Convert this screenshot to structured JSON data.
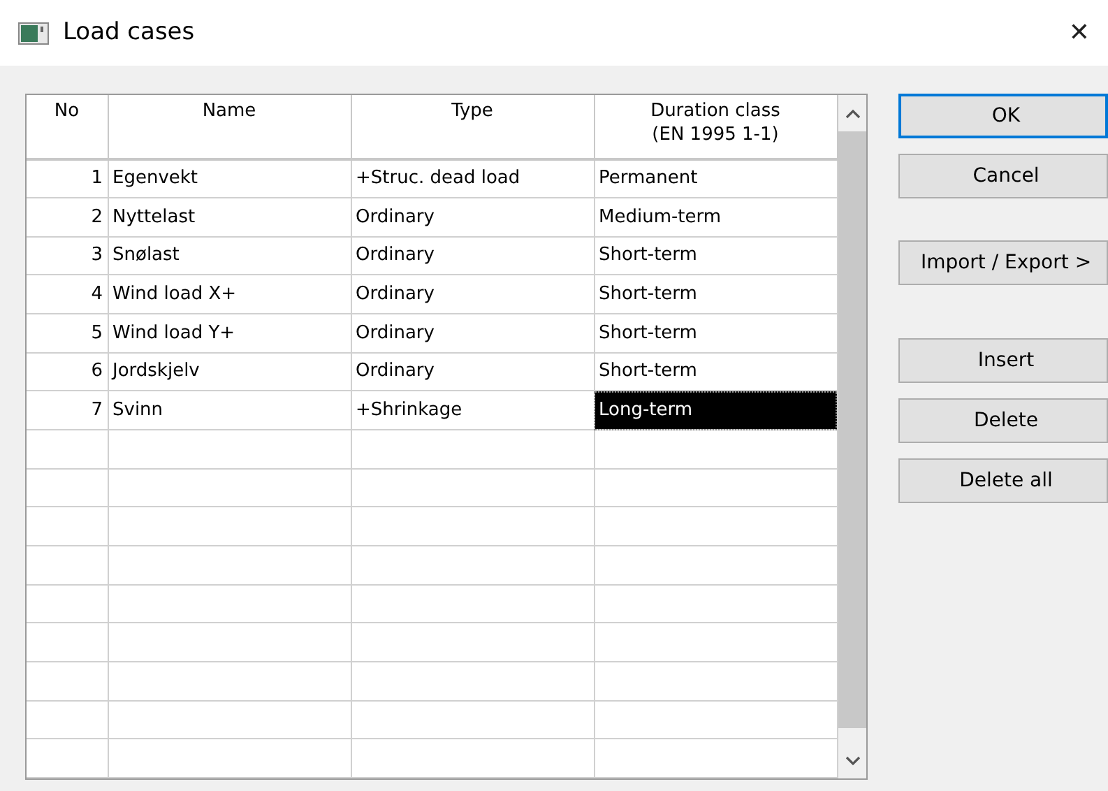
{
  "window": {
    "title": "Load cases",
    "close": "✕"
  },
  "table": {
    "columns": [
      {
        "label": "No"
      },
      {
        "label": "Name"
      },
      {
        "label": "Type"
      },
      {
        "label": "Duration class\n(EN 1995 1-1)"
      }
    ],
    "rows": [
      {
        "no": "1",
        "name": "Egenvekt",
        "type": "+Struc. dead load",
        "duration": "Permanent",
        "duration_selected": false
      },
      {
        "no": "2",
        "name": "Nyttelast",
        "type": "Ordinary",
        "duration": "Medium-term",
        "duration_selected": false
      },
      {
        "no": "3",
        "name": "Snølast",
        "type": "Ordinary",
        "duration": "Short-term",
        "duration_selected": false
      },
      {
        "no": "4",
        "name": "Wind load X+",
        "type": "Ordinary",
        "duration": "Short-term",
        "duration_selected": false
      },
      {
        "no": "5",
        "name": "Wind load Y+",
        "type": "Ordinary",
        "duration": "Short-term",
        "duration_selected": false
      },
      {
        "no": "6",
        "name": "Jordskjelv",
        "type": "Ordinary",
        "duration": "Short-term",
        "duration_selected": false
      },
      {
        "no": "7",
        "name": "Svinn",
        "type": "+Shrinkage",
        "duration": "Long-term",
        "duration_selected": true
      }
    ]
  },
  "button_groups": [
    [
      {
        "label": "OK",
        "default": true
      },
      {
        "label": "Cancel",
        "default": false
      }
    ],
    [
      {
        "label": "Import / Export >",
        "default": false
      }
    ],
    [
      {
        "label": "Insert",
        "default": false
      },
      {
        "label": "Delete",
        "default": false
      },
      {
        "label": "Delete all",
        "default": false
      }
    ]
  ]
}
